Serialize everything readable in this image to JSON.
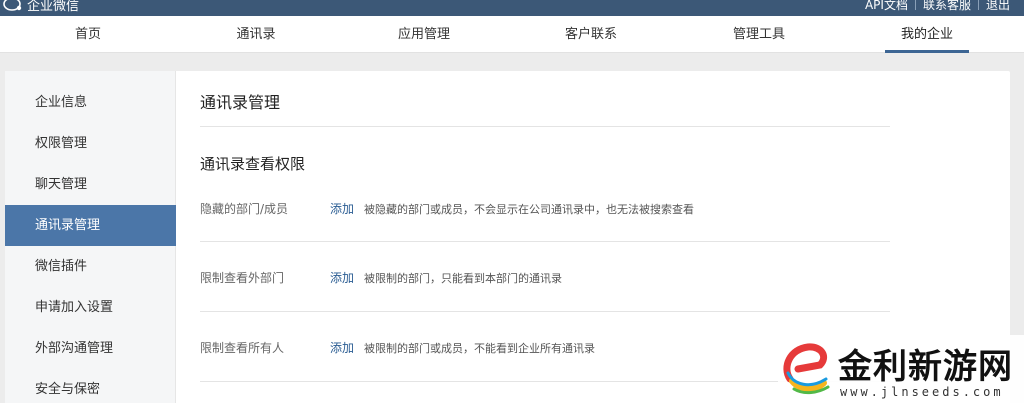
{
  "topbar": {
    "brand": "企业微信",
    "links": [
      "API文档",
      "联系客服",
      "退出"
    ]
  },
  "nav": {
    "items": [
      "首页",
      "通讯录",
      "应用管理",
      "客户联系",
      "管理工具",
      "我的企业"
    ],
    "active": "我的企业"
  },
  "sidebar": {
    "items": [
      "企业信息",
      "权限管理",
      "聊天管理",
      "通讯录管理",
      "微信插件",
      "申请加入设置",
      "外部沟通管理",
      "安全与保密"
    ],
    "active": "通讯录管理"
  },
  "main": {
    "title": "通讯录管理",
    "section_title": "通讯录查看权限",
    "rows": [
      {
        "label": "隐藏的部门/成员",
        "action": "添加",
        "desc": "被隐藏的部门或成员，不会显示在公司通讯录中，也无法被搜索查看"
      },
      {
        "label": "限制查看外部门",
        "action": "添加",
        "desc": "被限制的部门，只能看到本部门的通讯录"
      },
      {
        "label": "限制查看所有人",
        "action": "添加",
        "desc": "被限制的部门或成员，不能看到企业所有通讯录"
      }
    ]
  },
  "watermark": {
    "title": "金利新游网",
    "url": "www.jlnseeds.com"
  },
  "colors": {
    "topbar": "#3c5877",
    "accent": "#4b76a8",
    "link": "#2b5d93"
  }
}
